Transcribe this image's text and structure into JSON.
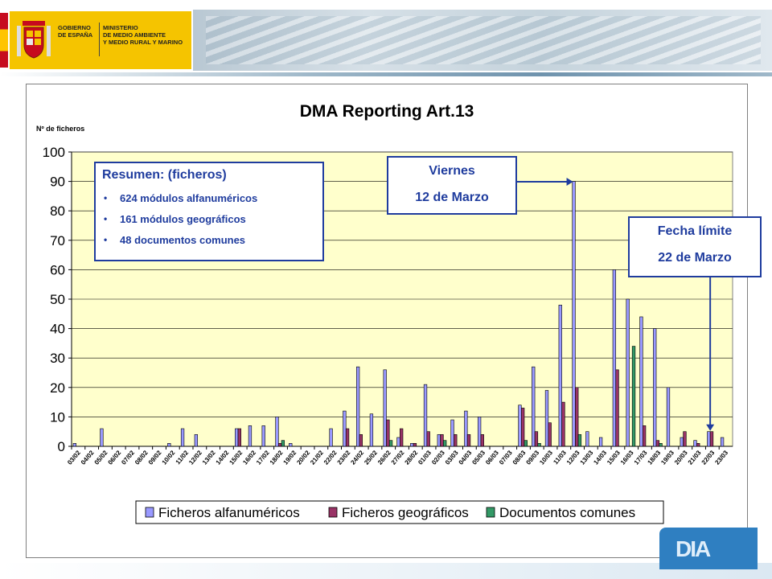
{
  "header": {
    "gov_text_1": "GOBIERNO\nDE ESPAÑA",
    "gov_text_2": "MINISTERIO\nDE MEDIO AMBIENTE\nY MEDIO RURAL Y MARINO"
  },
  "colors": {
    "plot_background": "#ffffcc",
    "series_alfa": "#9999ff",
    "series_geo": "#993366",
    "series_doc": "#339966",
    "annotation": "#1f3c9e",
    "logo_blue": "#2f7fc1"
  },
  "icons": {
    "shield": "spanish-coat-of-arms-icon",
    "logo": "dia-logo-icon"
  },
  "annotations": {
    "resumen_title": "Resumen: (ficheros)",
    "resumen_items": [
      "624 módulos alfanuméricos",
      "161 módulos geográficos",
      "48 documentos comunes"
    ],
    "bullet": "•",
    "viernes_line1": "Viernes",
    "viernes_line2": "12 de Marzo",
    "fecha_line1": "Fecha límite",
    "fecha_line2": "22 de Marzo"
  },
  "bottom_logo": {
    "text": "DIA"
  },
  "chart_data": {
    "type": "bar",
    "title": "DMA Reporting Art.13",
    "ylabel": "Nº de ficheros",
    "xlabel": "",
    "ylim": [
      0,
      100
    ],
    "yticks": [
      0,
      10,
      20,
      30,
      40,
      50,
      60,
      70,
      80,
      90,
      100
    ],
    "grid": true,
    "legend_position": "bottom",
    "categories": [
      "03/02",
      "04/02",
      "05/02",
      "06/02",
      "07/02",
      "08/02",
      "09/02",
      "10/02",
      "11/02",
      "12/02",
      "13/02",
      "14/02",
      "15/02",
      "16/02",
      "17/02",
      "18/02",
      "19/02",
      "20/02",
      "21/02",
      "22/02",
      "23/02",
      "24/02",
      "25/02",
      "26/02",
      "27/02",
      "28/02",
      "01/03",
      "02/03",
      "03/03",
      "04/03",
      "05/03",
      "06/03",
      "07/03",
      "08/03",
      "09/03",
      "10/03",
      "11/03",
      "12/03",
      "13/03",
      "14/03",
      "15/03",
      "16/03",
      "17/03",
      "18/03",
      "19/03",
      "20/03",
      "21/03",
      "22/03",
      "23/03"
    ],
    "series": [
      {
        "name": "Ficheros alfanuméricos",
        "values": [
          1,
          0,
          6,
          0,
          0,
          0,
          0,
          1,
          6,
          4,
          0,
          0,
          6,
          7,
          7,
          10,
          1,
          0,
          0,
          6,
          12,
          27,
          11,
          26,
          3,
          1,
          21,
          4,
          9,
          12,
          10,
          0,
          0,
          14,
          27,
          19,
          48,
          90,
          5,
          3,
          60,
          50,
          44,
          40,
          20,
          3,
          2,
          5,
          3
        ]
      },
      {
        "name": "Ficheros geográficos",
        "values": [
          0,
          0,
          0,
          0,
          0,
          0,
          0,
          0,
          0,
          0,
          0,
          0,
          6,
          0,
          0,
          1,
          0,
          0,
          0,
          0,
          6,
          4,
          0,
          9,
          6,
          1,
          5,
          4,
          4,
          4,
          4,
          0,
          0,
          13,
          5,
          8,
          15,
          20,
          0,
          0,
          26,
          0,
          7,
          2,
          0,
          5,
          1,
          5,
          0
        ]
      },
      {
        "name": "Documentos comunes",
        "values": [
          0,
          0,
          0,
          0,
          0,
          0,
          0,
          0,
          0,
          0,
          0,
          0,
          0,
          0,
          0,
          2,
          0,
          0,
          0,
          0,
          0,
          0,
          0,
          2,
          0,
          0,
          0,
          2,
          0,
          0,
          0,
          0,
          0,
          2,
          1,
          0,
          0,
          4,
          0,
          0,
          0,
          34,
          0,
          1,
          0,
          0,
          0,
          0,
          0
        ]
      }
    ]
  }
}
